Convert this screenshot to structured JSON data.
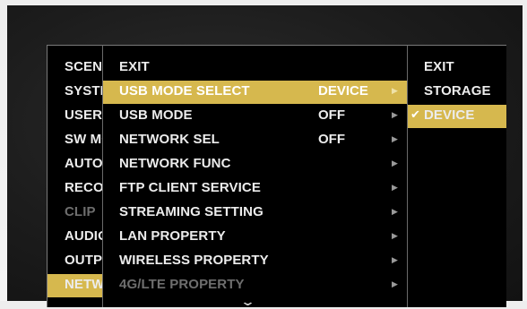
{
  "left_menu": {
    "items": [
      {
        "label": "SCENE",
        "state": "normal"
      },
      {
        "label": "SYSTEM",
        "state": "normal"
      },
      {
        "label": "USER",
        "state": "normal"
      },
      {
        "label": "SW MODE",
        "state": "normal"
      },
      {
        "label": "AUTO",
        "state": "normal"
      },
      {
        "label": "RECORDING",
        "state": "normal"
      },
      {
        "label": "CLIP",
        "state": "disabled"
      },
      {
        "label": "AUDIO",
        "state": "normal"
      },
      {
        "label": "OUTPUT",
        "state": "normal"
      },
      {
        "label": "NETWORK",
        "state": "selected"
      }
    ]
  },
  "main_menu": {
    "items": [
      {
        "label": "EXIT",
        "value": "",
        "has_submenu": false,
        "state": "normal"
      },
      {
        "label": "USB MODE SELECT",
        "value": "DEVICE",
        "has_submenu": true,
        "state": "selected"
      },
      {
        "label": "USB MODE",
        "value": "OFF",
        "has_submenu": true,
        "state": "normal"
      },
      {
        "label": "NETWORK SEL",
        "value": "OFF",
        "has_submenu": true,
        "state": "normal"
      },
      {
        "label": "NETWORK FUNC",
        "value": "",
        "has_submenu": true,
        "state": "normal"
      },
      {
        "label": "FTP CLIENT SERVICE",
        "value": "",
        "has_submenu": true,
        "state": "normal"
      },
      {
        "label": "STREAMING SETTING",
        "value": "",
        "has_submenu": true,
        "state": "normal"
      },
      {
        "label": "LAN PROPERTY",
        "value": "",
        "has_submenu": true,
        "state": "normal"
      },
      {
        "label": "WIRELESS PROPERTY",
        "value": "",
        "has_submenu": true,
        "state": "normal"
      },
      {
        "label": "4G/LTE PROPERTY",
        "value": "",
        "has_submenu": true,
        "state": "disabled"
      }
    ],
    "more_indicator": "⌄"
  },
  "sub_menu": {
    "items": [
      {
        "label": "EXIT",
        "checked": false,
        "state": "normal"
      },
      {
        "label": "STORAGE",
        "checked": false,
        "state": "normal"
      },
      {
        "label": "DEVICE",
        "checked": true,
        "state": "selected"
      }
    ]
  },
  "icons": {
    "submenu_arrow": "▶",
    "check_mark": "✔"
  },
  "colors": {
    "highlight": "#d6b84e",
    "menu_background": "#000000",
    "text": "#ececec",
    "disabled_text": "#6e6e6e"
  }
}
